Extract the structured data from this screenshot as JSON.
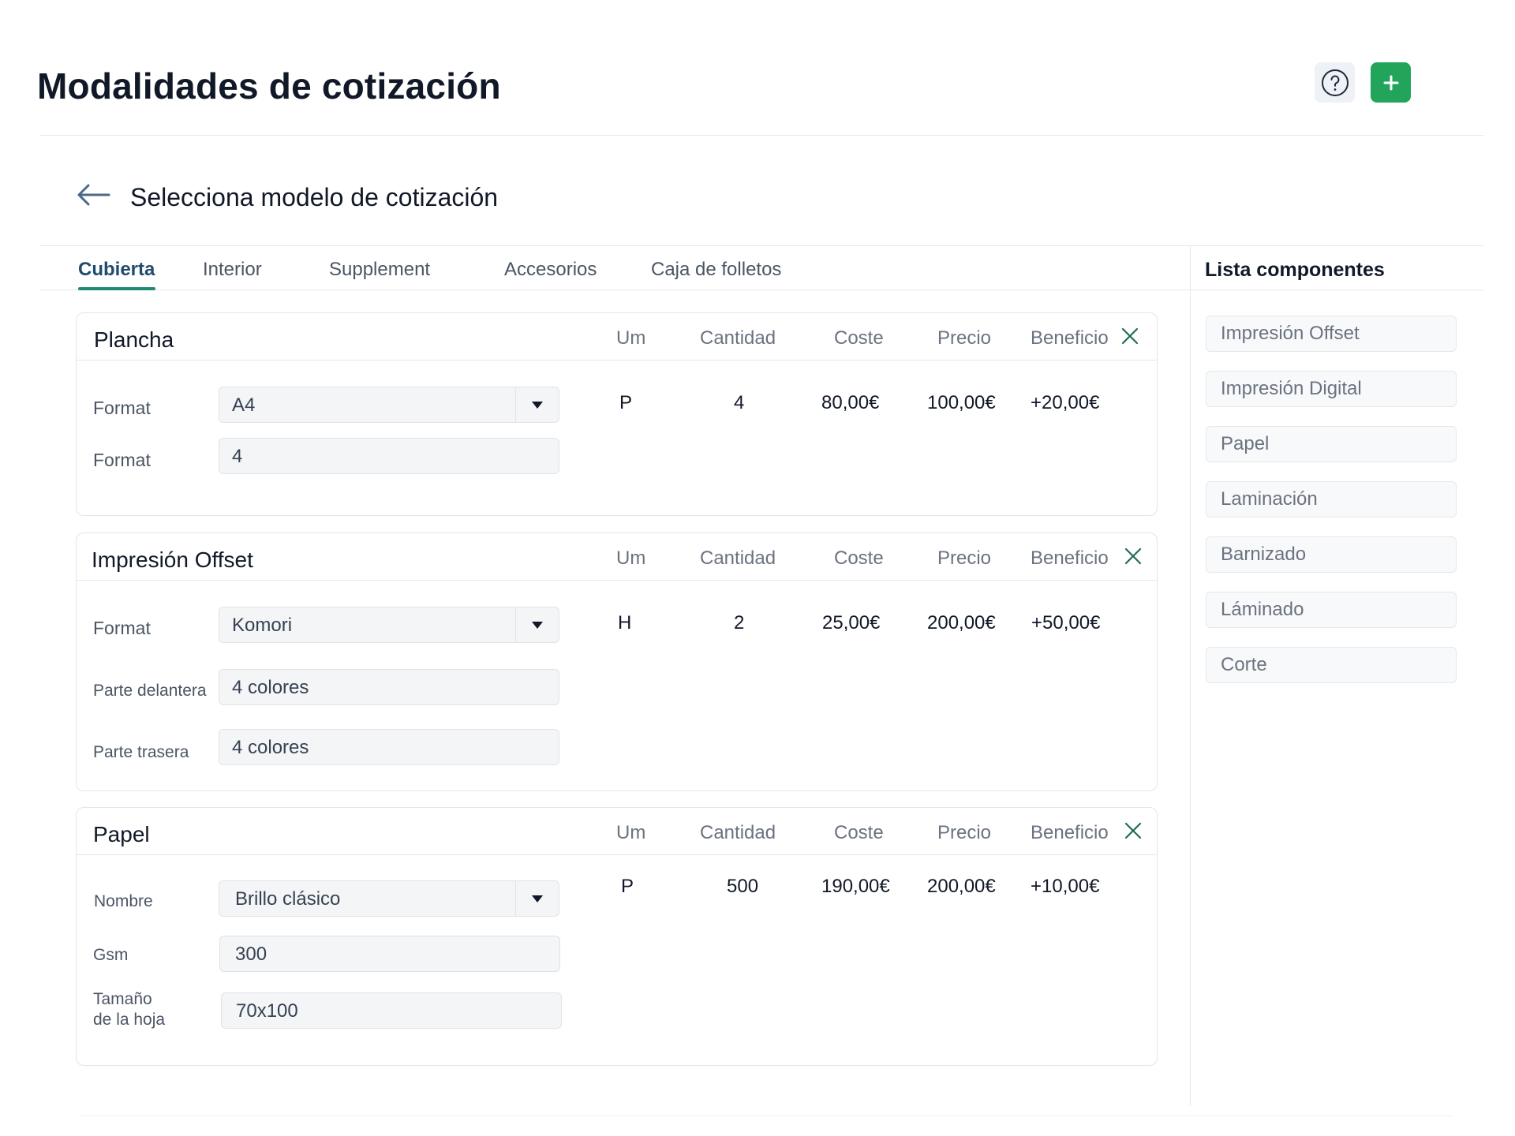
{
  "header": {
    "title": "Modalidades de cotización",
    "help_icon": "question-circle-icon",
    "add_icon": "plus-icon",
    "accent_color": "#22a55b"
  },
  "section": {
    "title": "Selecciona modelo de cotización",
    "back_icon": "arrow-left-icon"
  },
  "tabs": [
    {
      "label": "Cubierta",
      "active": true
    },
    {
      "label": "Interior"
    },
    {
      "label": "Supplement"
    },
    {
      "label": "Accesorios"
    },
    {
      "label": "Caja de folletos"
    }
  ],
  "columns": {
    "um": "Um",
    "cantidad": "Cantidad",
    "coste": "Coste",
    "precio": "Precio",
    "beneficio": "Beneficio"
  },
  "cards": [
    {
      "title": "Plancha",
      "fields": [
        {
          "label": "Format",
          "value": "A4",
          "type": "select"
        },
        {
          "label": "Format",
          "value": "4",
          "type": "text"
        }
      ],
      "values": {
        "um": "P",
        "cantidad": "4",
        "coste": "80,00€",
        "precio": "100,00€",
        "beneficio": "+20,00€"
      }
    },
    {
      "title": "Impresión Offset",
      "fields": [
        {
          "label": "Format",
          "value": "Komori",
          "type": "select"
        },
        {
          "label": "Parte delantera",
          "value": "4 colores",
          "type": "text"
        },
        {
          "label": "Parte trasera",
          "value": "4 colores",
          "type": "text"
        }
      ],
      "values": {
        "um": "H",
        "cantidad": "2",
        "coste": "25,00€",
        "precio": "200,00€",
        "beneficio": "+50,00€"
      }
    },
    {
      "title": "Papel",
      "fields": [
        {
          "label": "Nombre",
          "value": "Brillo clásico",
          "type": "select"
        },
        {
          "label": "Gsm",
          "value": "300",
          "type": "text"
        },
        {
          "label": "Tamaño de la hoja",
          "label_line1": "Tamaño",
          "label_line2": "de la hoja",
          "value": "70x100",
          "type": "text"
        }
      ],
      "values": {
        "um": "P",
        "cantidad": "500",
        "coste": "190,00€",
        "precio": "200,00€",
        "beneficio": "+10,00€"
      }
    }
  ],
  "sidebar": {
    "title": "Lista componentes",
    "items": [
      {
        "label": "Impresión Offset"
      },
      {
        "label": "Impresión Digital"
      },
      {
        "label": "Papel"
      },
      {
        "label": "Laminación"
      },
      {
        "label": "Barnizado"
      },
      {
        "label": "Láminado"
      },
      {
        "label": "Corte"
      }
    ]
  }
}
